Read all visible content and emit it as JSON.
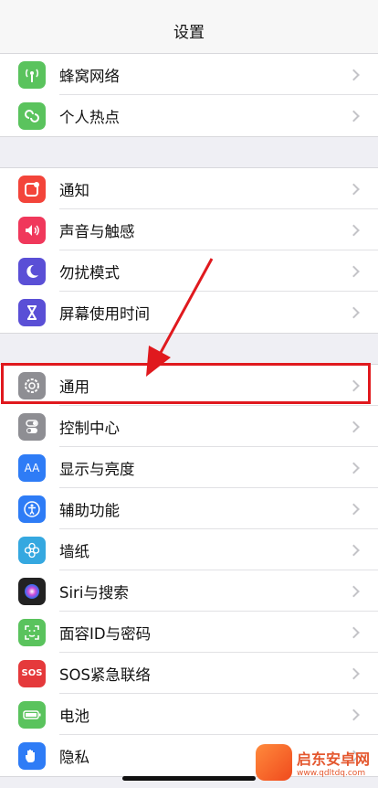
{
  "nav": {
    "title": "设置"
  },
  "group1": [
    {
      "label": "蜂窝网络",
      "icon": "antenna-icon",
      "color": "#5ac35d"
    },
    {
      "label": "个人热点",
      "icon": "hotspot-icon",
      "color": "#5ac35d"
    }
  ],
  "group2": [
    {
      "label": "通知",
      "icon": "notification-icon",
      "color": "#f3443a"
    },
    {
      "label": "声音与触感",
      "icon": "speaker-icon",
      "color": "#f0385b"
    },
    {
      "label": "勿扰模式",
      "icon": "moon-icon",
      "color": "#5a4fd6"
    },
    {
      "label": "屏幕使用时间",
      "icon": "hourglass-icon",
      "color": "#5a4fd6"
    }
  ],
  "group3": [
    {
      "label": "通用",
      "icon": "gear-icon",
      "color": "#8e8e93"
    },
    {
      "label": "控制中心",
      "icon": "toggles-icon",
      "color": "#8e8e93"
    },
    {
      "label": "显示与亮度",
      "icon": "text-size-icon",
      "color": "#2e7cf6"
    },
    {
      "label": "辅助功能",
      "icon": "accessibility-icon",
      "color": "#2e7cf6"
    },
    {
      "label": "墙纸",
      "icon": "flower-icon",
      "color": "#35a8e0"
    },
    {
      "label": "Siri与搜索",
      "icon": "siri-icon",
      "color": "#222222"
    },
    {
      "label": "面容ID与密码",
      "icon": "faceid-icon",
      "color": "#5ac35d"
    },
    {
      "label": "SOS紧急联络",
      "icon": "sos-icon",
      "color": "#e5393b"
    },
    {
      "label": "电池",
      "icon": "battery-icon",
      "color": "#5ac35d"
    },
    {
      "label": "隐私",
      "icon": "hand-icon",
      "color": "#2e7cf6"
    }
  ],
  "icon_glyphs": {
    "sos": "SOS",
    "text_size": "AA"
  },
  "watermark": {
    "name": "启东安卓网",
    "url": "www.qdltdq.com"
  },
  "annotation": {
    "color": "#e0191e",
    "highlighted": "通用"
  }
}
